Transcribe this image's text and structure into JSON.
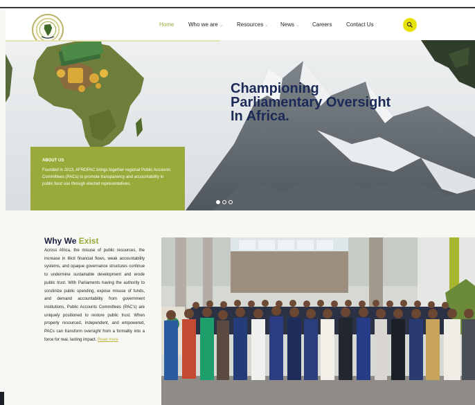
{
  "nav": {
    "items": [
      {
        "label": "Home",
        "active": true
      },
      {
        "label": "Who we are",
        "dropdown": true
      },
      {
        "label": "Resources",
        "dropdown": true
      },
      {
        "label": "News",
        "dropdown": true
      },
      {
        "label": "Careers",
        "dropdown": false
      },
      {
        "label": "Contact Us",
        "dropdown": false
      }
    ],
    "caret": "⌄",
    "search_icon": "search-icon"
  },
  "hero": {
    "title_line1": "Championing",
    "title_line2": "Parliamentary Oversight",
    "title_line3": "In Africa.",
    "about_heading": "ABOUT US",
    "about_text": "Founded in 2013, AFROPAC brings together regional Public Accounts Committees (PACs) to promote transparency and accountability in public fund use through elected representatives.",
    "slides": 3,
    "active_slide": 1
  },
  "why": {
    "title_main": "Why We",
    "title_accent": "Exist",
    "body": "Across Africa, the misuse of public resources, the increase in illicit financial flows, weak accountability systems, and opaque governance structures continue to undermine sustainable development and erode public trust. With Parliaments having the authority to scrutinize public spending, expose misuse of funds, and demand accountability from government institutions, Public Accounts Committees (PAC's) are uniquely positioned to restore public trust. When properly resourced, independent, and empowered, PACs can transform oversight from a formality into a force for real, lasting impact.",
    "read_more": "Read more"
  },
  "colors": {
    "accent": "#9aaa3a",
    "navy": "#1b2a57",
    "search": "#e7e300"
  }
}
